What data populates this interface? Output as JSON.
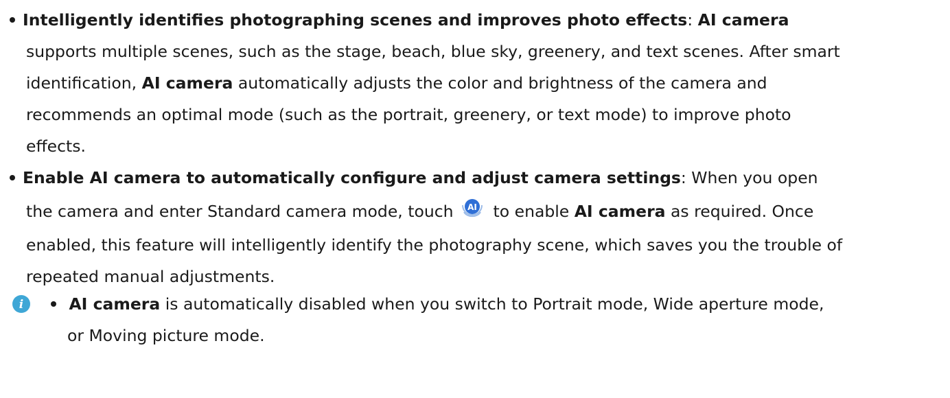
{
  "bullet1": {
    "heading": "Intelligently identifies photographing scenes and improves photo effects",
    "colon": ":",
    "ai_camera_1": "AI camera",
    "line2": "supports multiple scenes, such as the stage, beach, blue sky, greenery, and text scenes. After smart",
    "line3_pre": "identification,",
    "ai_camera_2": "AI camera",
    "line3_post": "automatically adjusts the color and brightness of the camera and",
    "line4": "recommends an optimal mode (such as the portrait, greenery, or text mode) to improve photo",
    "line5": "effects."
  },
  "bullet2": {
    "heading": "Enable AI camera to automatically configure and adjust camera settings",
    "colon_post": ": When you open",
    "line2_pre": "the camera and enter Standard camera mode, touch",
    "line2_mid": "to enable",
    "ai_camera": "AI camera",
    "line2_post": "as required. Once",
    "line3": "enabled, this feature will intelligently identify the photography scene, which saves you the trouble of",
    "line4": "repeated manual adjustments."
  },
  "note": {
    "ai_camera": "AI camera",
    "line1_post": "is automatically disabled when you switch to Portrait mode, Wide aperture mode,",
    "line2": "or Moving picture mode."
  },
  "icons": {
    "ai_badge": "ai-camera-icon",
    "info": "info-icon"
  },
  "colors": {
    "ai_badge": "#2f6fd6",
    "info_icon": "#3fa7d6",
    "text": "#1a1a1a"
  }
}
